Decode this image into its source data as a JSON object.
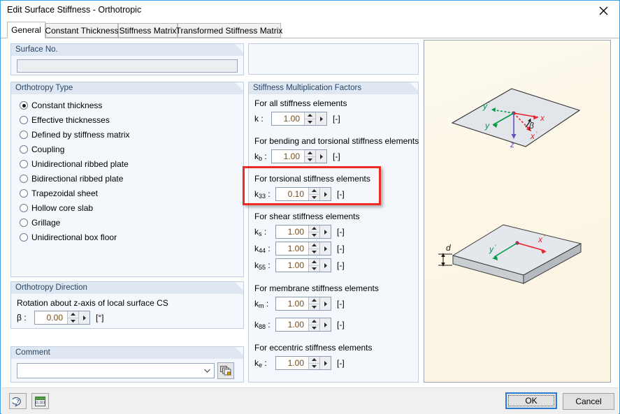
{
  "window": {
    "title": "Edit Surface Stiffness - Orthotropic",
    "close_icon": "close-icon"
  },
  "tabs": [
    {
      "label": "General",
      "active": true
    },
    {
      "label": "Constant Thickness",
      "active": false
    },
    {
      "label": "Stiffness Matrix",
      "active": false
    },
    {
      "label": "Transformed Stiffness Matrix",
      "active": false
    }
  ],
  "surface_no": {
    "header": "Surface No.",
    "value": ""
  },
  "orthotropy_type": {
    "header": "Orthotropy Type",
    "options": [
      {
        "label": "Constant thickness",
        "selected": true
      },
      {
        "label": "Effective thicknesses",
        "selected": false
      },
      {
        "label": "Defined by stiffness matrix",
        "selected": false
      },
      {
        "label": "Coupling",
        "selected": false
      },
      {
        "label": "Unidirectional ribbed plate",
        "selected": false
      },
      {
        "label": "Bidirectional ribbed plate",
        "selected": false
      },
      {
        "label": "Trapezoidal sheet",
        "selected": false
      },
      {
        "label": "Hollow core slab",
        "selected": false
      },
      {
        "label": "Grillage",
        "selected": false
      },
      {
        "label": "Unidirectional box floor",
        "selected": false
      }
    ]
  },
  "orthotropy_direction": {
    "header": "Orthotropy Direction",
    "description": "Rotation about z-axis of local surface CS",
    "beta_label": "β :",
    "beta_value": "0.00",
    "beta_unit": "[°]"
  },
  "comment": {
    "header": "Comment",
    "value": "",
    "dropdown_icon": "chevron-down-icon",
    "picker_icon": "copy-layers-icon"
  },
  "stiffness_factors": {
    "header": "Stiffness Multiplication Factors",
    "groups": [
      {
        "caption": "For all stiffness elements",
        "highlighted": false,
        "fields": [
          {
            "label": "k :",
            "sub": "",
            "value": "1.00",
            "unit": "[-]"
          }
        ]
      },
      {
        "caption": "For bending and torsional stiffness elements",
        "highlighted": false,
        "fields": [
          {
            "label": "k",
            "sub": "b",
            "suffix": " :",
            "value": "1.00",
            "unit": "[-]"
          }
        ]
      },
      {
        "caption": "For torsional stiffness elements",
        "highlighted": true,
        "fields": [
          {
            "label": "k",
            "sub": "33",
            "suffix": " :",
            "value": "0.10",
            "unit": "[-]"
          }
        ]
      },
      {
        "caption": "For shear stiffness elements",
        "highlighted": false,
        "fields": [
          {
            "label": "k",
            "sub": "s",
            "suffix": " :",
            "value": "1.00",
            "unit": "[-]"
          },
          {
            "label": "k",
            "sub": "44",
            "suffix": " :",
            "value": "1.00",
            "unit": "[-]"
          },
          {
            "label": "k",
            "sub": "55",
            "suffix": " :",
            "value": "1.00",
            "unit": "[-]"
          }
        ]
      },
      {
        "caption": "For membrane stiffness elements",
        "highlighted": false,
        "fields": [
          {
            "label": "k",
            "sub": "m",
            "suffix": " :",
            "value": "1.00",
            "unit": "[-]"
          },
          {
            "label": "k",
            "sub": "88",
            "suffix": " :",
            "value": "1.00",
            "unit": "[-]"
          }
        ]
      },
      {
        "caption": "For eccentric stiffness elements",
        "highlighted": false,
        "fields": [
          {
            "label": "k",
            "sub": "e",
            "suffix": " :",
            "value": "1.00",
            "unit": "[-]"
          }
        ]
      }
    ]
  },
  "graphics": {
    "top_diagram": {
      "labels": [
        "y'",
        "y",
        "x",
        "x'",
        "z",
        "β"
      ],
      "colors": {
        "local_axis": "#009a44",
        "global_axis": "#e8232a",
        "z_axis": "#6a4fbb",
        "origin": "#a0247a"
      }
    },
    "bottom_diagram": {
      "labels": [
        "d",
        "y'",
        "x'"
      ]
    }
  },
  "footer": {
    "help_icon": "help-question-icon",
    "units_icon": "units-00-icon",
    "ok_label": "OK",
    "cancel_label": "Cancel"
  }
}
